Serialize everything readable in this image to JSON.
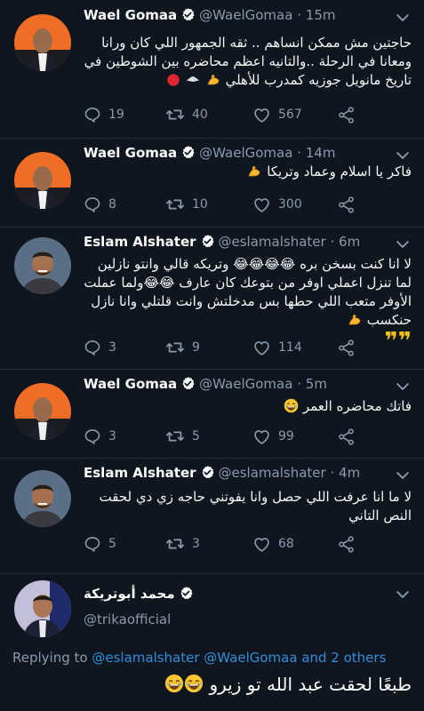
{
  "tweets": [
    {
      "name": "Wael Gomaa",
      "handle": "@WaelGomaa",
      "time": "15m",
      "text": "حاجتين مش ممكن انساهم .. ثقه الجمهور اللي كان ورانا ومعانا في الرحلة ..والتانيه اعظم محاضره بين الشوطين في تاريخ مانويل جوزيه كمدرب للأهلي",
      "replies": "19",
      "retweets": "40",
      "likes": "567"
    },
    {
      "name": "Wael Gomaa",
      "handle": "@WaelGomaa",
      "time": "14m",
      "text": "فاكر يا اسلام وعماد وتريكا",
      "replies": "8",
      "retweets": "10",
      "likes": "300"
    },
    {
      "name": "Eslam Alshater",
      "handle": "@eslamalshater",
      "time": "6m",
      "text": "لا انا كنت بسخن بره 😂😂😂😂 وتريكه قالي وانتو نازلين لما تنزل اعملي اوفر من بتوعك كان عارف 😂😂ولما عملت الأوفر متعب اللي حطها بس مدخلتش وانت قلتلي وانا نازل حنكسب",
      "replies": "3",
      "retweets": "9",
      "likes": "114"
    },
    {
      "name": "Wael Gomaa",
      "handle": "@WaelGomaa",
      "time": "5m",
      "text": "فاتك محاضره العمر",
      "replies": "3",
      "retweets": "5",
      "likes": "99"
    },
    {
      "name": "Eslam Alshater",
      "handle": "@eslamalshater",
      "time": "4m",
      "text": "لا ما انا عرفت اللي حصل وانا يفوتني حاجه زي دي لحقت النص التاني",
      "replies": "5",
      "retweets": "3",
      "likes": "68"
    }
  ],
  "main_tweet": {
    "name": "محمد أبوتريكة",
    "handle": "@trikaofficial",
    "replying_prefix": "Replying to",
    "replying_to": "@eslamalshater @WaelGomaa and 2 others",
    "text": "طبعًا لحقت عبد الله تو زيرو"
  },
  "separator": "·",
  "colors": {
    "background": "#0f1620",
    "accent": "#1da1f2",
    "link": "#2f8fd8",
    "muted": "#8a9aaa"
  }
}
